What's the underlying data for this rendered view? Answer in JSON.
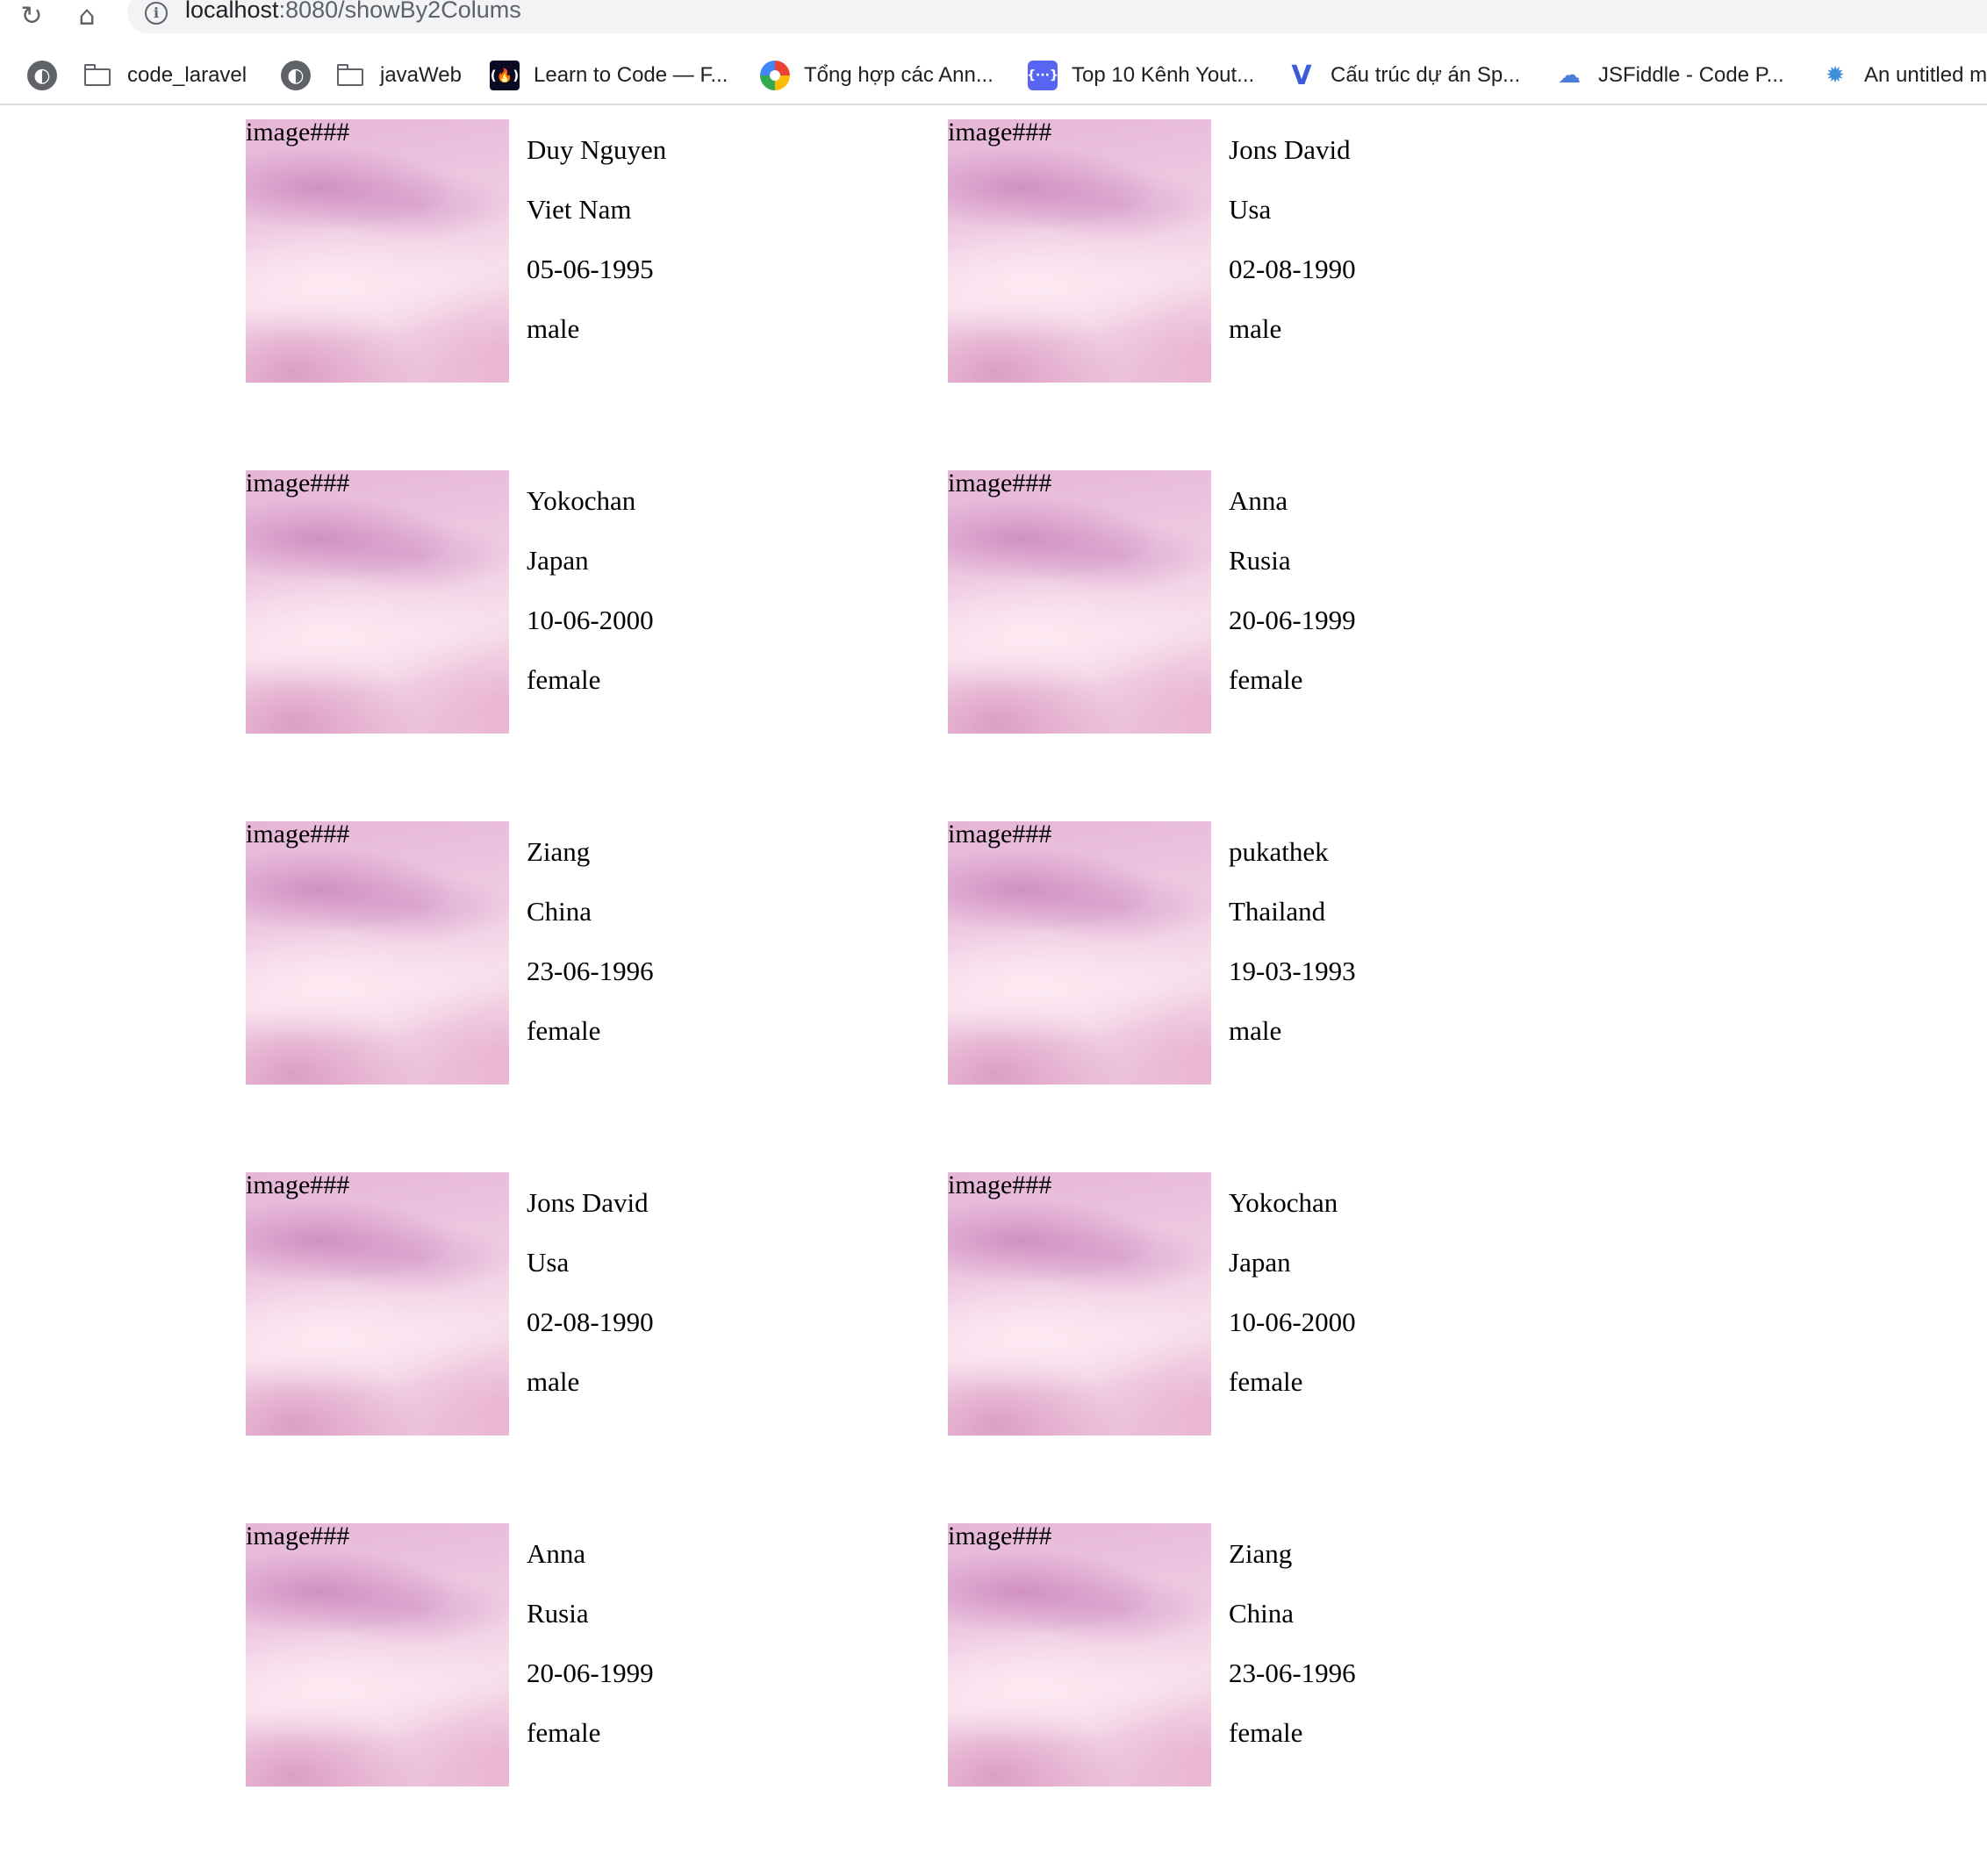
{
  "browser": {
    "url_host": "localhost",
    "url_rest": ":8080/showBy2Colums",
    "reload_glyph": "↻",
    "home_glyph": "⌂",
    "info_glyph": "i",
    "bookmarks": [
      {
        "label": "",
        "icon": "globe-icon",
        "glyph": "◐"
      },
      {
        "label": "code_laravel",
        "icon": "folder-icon",
        "glyph": ""
      },
      {
        "label": "",
        "icon": "globe-icon",
        "glyph": "◐"
      },
      {
        "label": "javaWeb",
        "icon": "folder-icon",
        "glyph": ""
      },
      {
        "label": "Learn to Code — F...",
        "icon": "freecodecamp-icon",
        "glyph": "(🔥)"
      },
      {
        "label": "Tổng hợp các Ann...",
        "icon": "color-wheel-icon",
        "glyph": ""
      },
      {
        "label": "Top 10 Kênh Yout...",
        "icon": "dev-icon",
        "glyph": "{···}"
      },
      {
        "label": "Cấu trúc dự án Sp...",
        "icon": "vuetify-icon",
        "glyph": "V"
      },
      {
        "label": "JSFiddle - Code P...",
        "icon": "cloud-icon",
        "glyph": "☁"
      },
      {
        "label": "An untitled m",
        "icon": "bug-icon",
        "glyph": "✹"
      }
    ]
  },
  "people": [
    {
      "image_alt": "image###",
      "name": "Duy Nguyen",
      "country": "Viet Nam",
      "dob": "05-06-1995",
      "gender": "male"
    },
    {
      "image_alt": "image###",
      "name": "Jons David",
      "country": "Usa",
      "dob": "02-08-1990",
      "gender": "male"
    },
    {
      "image_alt": "image###",
      "name": "Yokochan",
      "country": "Japan",
      "dob": "10-06-2000",
      "gender": "female"
    },
    {
      "image_alt": "image###",
      "name": "Anna",
      "country": "Rusia",
      "dob": "20-06-1999",
      "gender": "female"
    },
    {
      "image_alt": "image###",
      "name": "Ziang",
      "country": "China",
      "dob": "23-06-1996",
      "gender": "female"
    },
    {
      "image_alt": "image###",
      "name": "pukathek",
      "country": "Thailand",
      "dob": "19-03-1993",
      "gender": "male"
    },
    {
      "image_alt": "image###",
      "name": "Jons David",
      "country": "Usa",
      "dob": "02-08-1990",
      "gender": "male"
    },
    {
      "image_alt": "image###",
      "name": "Yokochan",
      "country": "Japan",
      "dob": "10-06-2000",
      "gender": "female"
    },
    {
      "image_alt": "image###",
      "name": "Anna",
      "country": "Rusia",
      "dob": "20-06-1999",
      "gender": "female"
    },
    {
      "image_alt": "image###",
      "name": "Ziang",
      "country": "China",
      "dob": "23-06-1996",
      "gender": "female"
    }
  ]
}
